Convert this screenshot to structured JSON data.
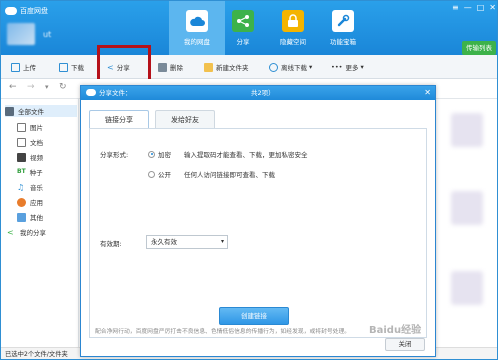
{
  "app": {
    "title": "百度网盘",
    "username": "ut"
  },
  "nav": [
    {
      "label": "我的网盘",
      "color": "#ffffff"
    },
    {
      "label": "分享",
      "color": "#3db24a"
    },
    {
      "label": "隐藏空间",
      "color": "#f4b400"
    },
    {
      "label": "功能宝箱",
      "color": "#ffffff"
    }
  ],
  "window_controls": [
    "≡",
    "—",
    "□",
    "✕"
  ],
  "transfer_button": "传输列表",
  "toolbar": {
    "upload": "上传",
    "download": "下载",
    "share": "分享",
    "delete": "删除",
    "new_folder": "新建文件夹",
    "offline": "离线下载",
    "more": "更多"
  },
  "sidebar": [
    {
      "label": "全部文件"
    },
    {
      "label": "图片"
    },
    {
      "label": "文档"
    },
    {
      "label": "视频"
    },
    {
      "label": "种子"
    },
    {
      "label": "音乐"
    },
    {
      "label": "应用"
    },
    {
      "label": "其他"
    },
    {
      "label": "我的分享"
    }
  ],
  "dialog": {
    "title": "分享文件：",
    "count": "共2项）",
    "tabs": [
      "链接分享",
      "发给好友"
    ],
    "share_form_label": "分享形式:",
    "option_encrypt": "加密",
    "option_encrypt_desc": "输入提取码才能查看、下载，更加私密安全",
    "option_public": "公开",
    "option_public_desc": "任何人访问链接即可查看、下载",
    "validity_label": "有效期:",
    "validity_value": "永久有效",
    "create_button": "创建链接",
    "notice": "配合净网行动，百度网盘严厉打击不良信息、色情低俗信息的传播行为，如经发现，或将封号处理。",
    "close_button": "关闭"
  },
  "status": "已选中2个文件/文件夹",
  "watermark": "Baidu经验",
  "colors": {
    "header": "#1a86d8",
    "highlight": "#b5111a",
    "accent": "#2f97e6"
  }
}
